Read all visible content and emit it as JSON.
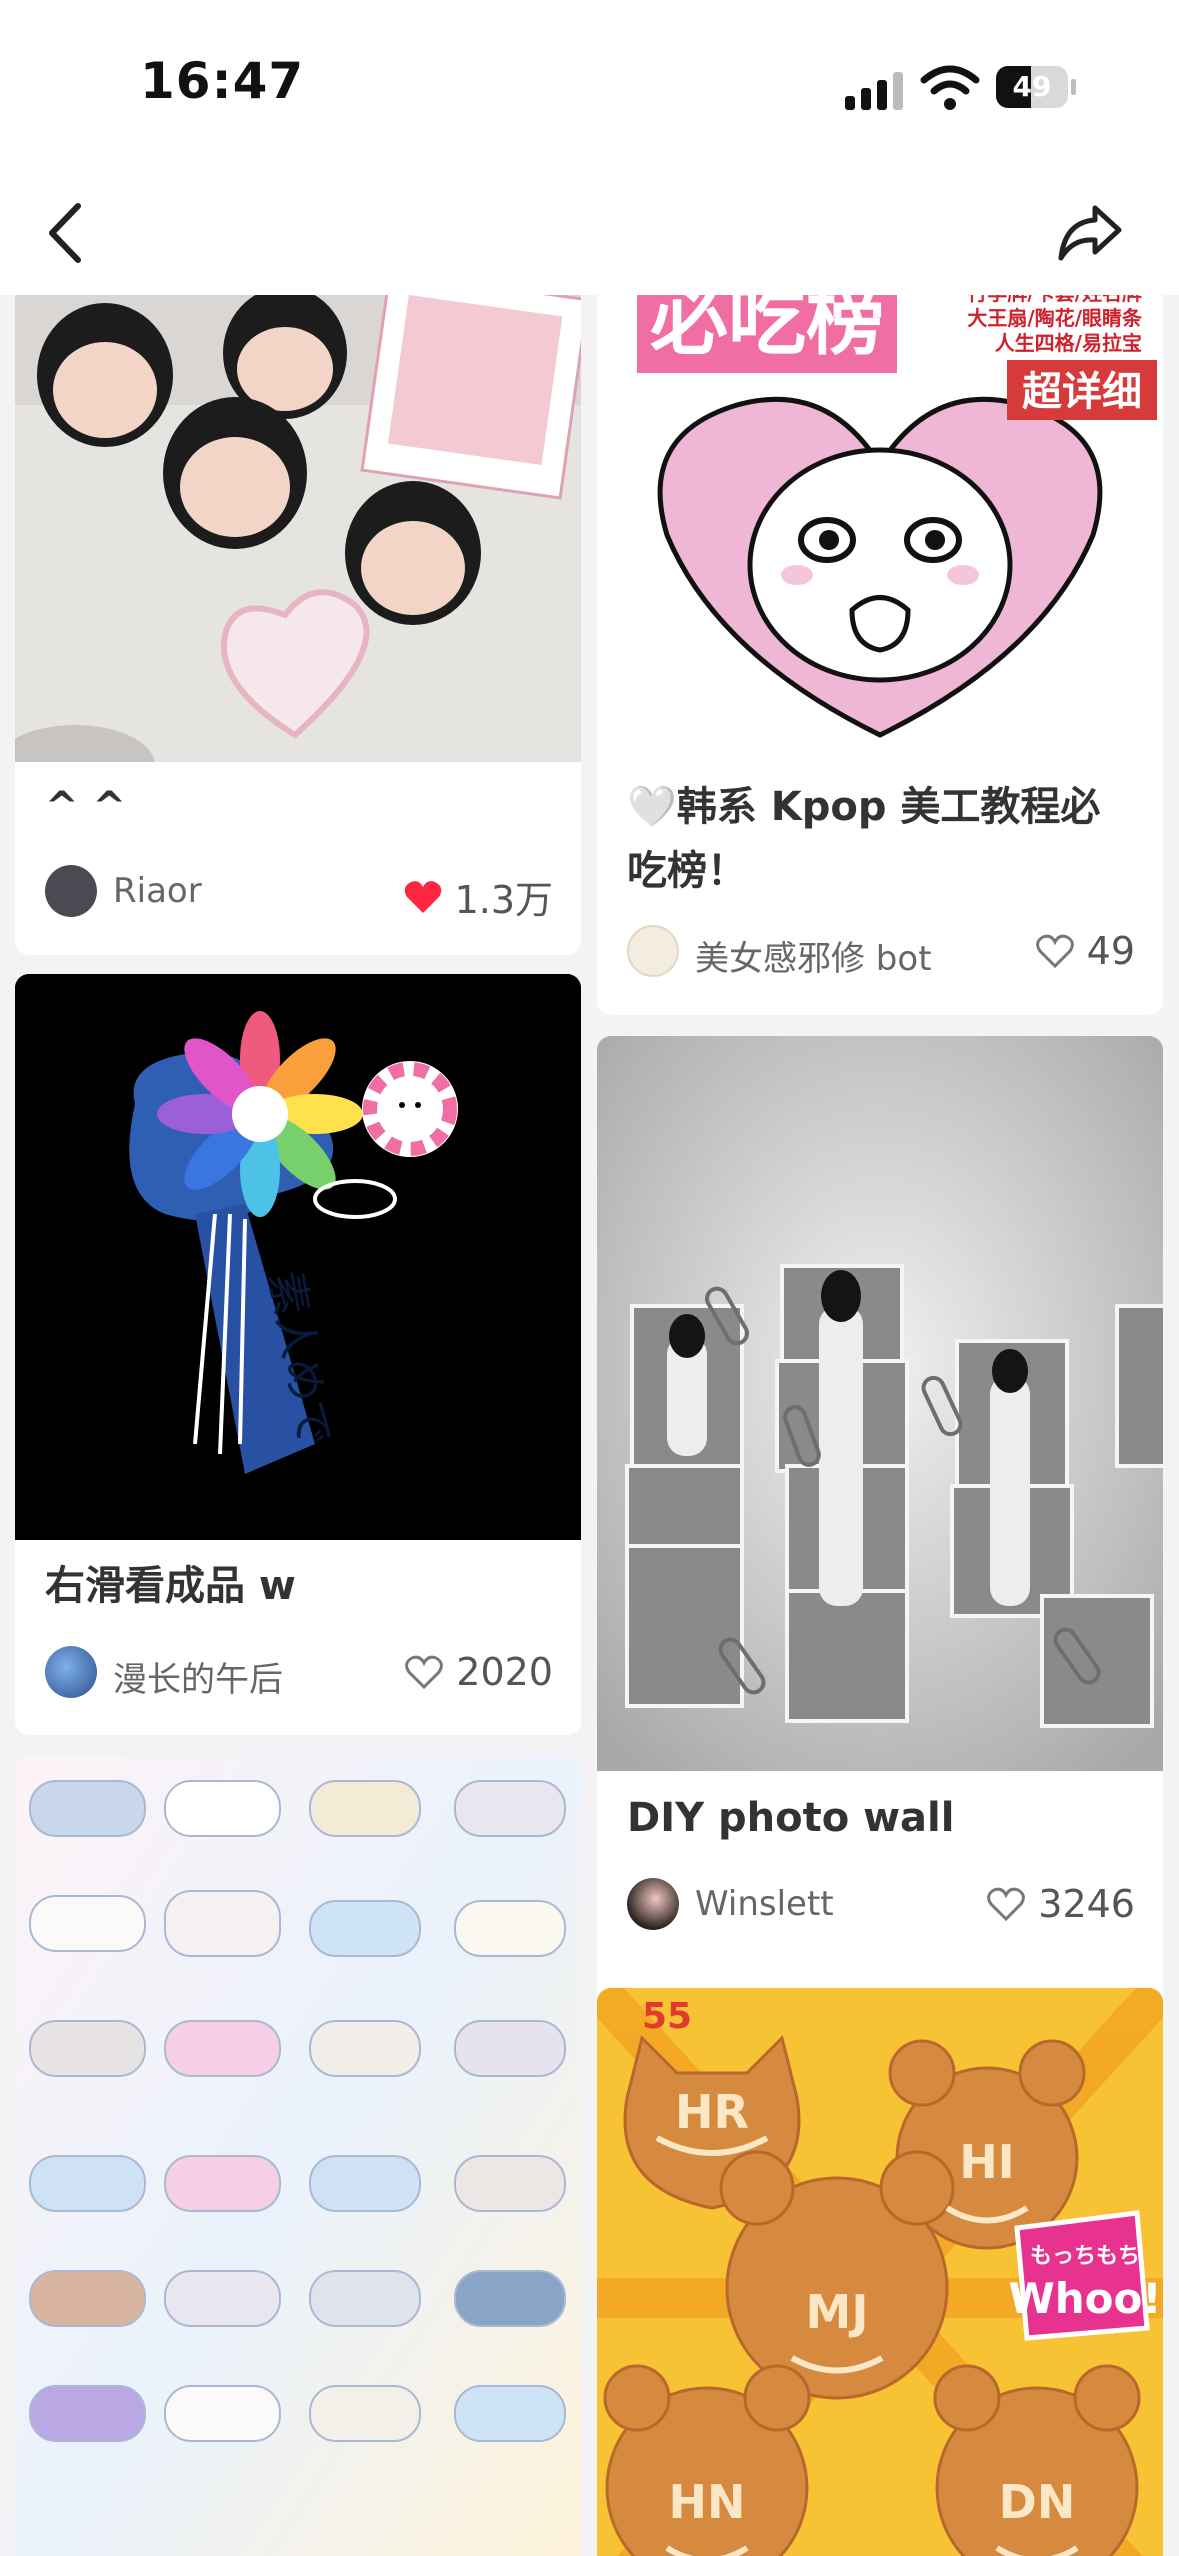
{
  "status_bar": {
    "time": "16:47",
    "battery": "49",
    "battery_level": 0.49
  },
  "feed": {
    "left": [
      {
        "title": "^ ^",
        "author": "Riaor",
        "likes": "1.3万",
        "liked": true
      },
      {
        "title": "右滑看成品 w",
        "author": "漫长的午后",
        "likes": "2020",
        "liked": false,
        "image_text": "素人めで"
      },
      {
        "title": "",
        "author": "",
        "likes": ""
      }
    ],
    "right": [
      {
        "title": "🤍韩系 Kpop 美工教程必吃榜！",
        "author": "美女感邪修 bot",
        "likes": "49",
        "liked": false,
        "image_text": {
          "headline": "必吃榜",
          "badge": "超详细",
          "side_lines": [
            "行李牌/卡套/姓名牌",
            "大王扇/陶花/眼睛条",
            "人生四格/易拉宝"
          ]
        }
      },
      {
        "title": "DIY photo wall",
        "author": "Winslett",
        "likes": "3246",
        "liked": false
      },
      {
        "title": "",
        "author": "",
        "likes": "",
        "image_text": {
          "badge": "55",
          "bun_letters": [
            "HR",
            "HI",
            "MJ",
            "HN",
            "DN"
          ],
          "whoo_top": "もっちもち",
          "whoo_bottom": "Whoo!"
        }
      }
    ]
  },
  "colors": {
    "like_red": "#ff2442",
    "text_dark": "#333333",
    "text_gray": "#666666",
    "pink_banner": "#f06ea3"
  }
}
